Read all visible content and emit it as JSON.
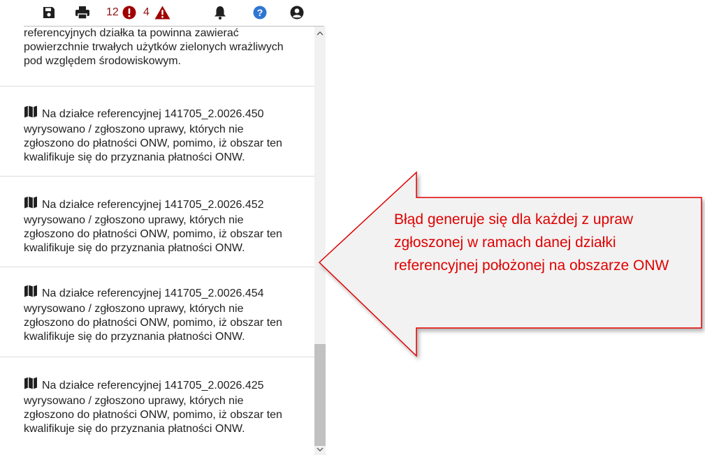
{
  "toolbar": {
    "save_icon": "save-icon",
    "print_icon": "print-icon",
    "error_count": "12",
    "warning_count": "4",
    "error_color": "#a00000",
    "warning_color": "#a00000"
  },
  "messages": [
    {
      "text": "referencyjnych działka ta powinna zawierać powierzchnie trwałych użytków zielonych wrażliwych pod względem środowiskowym.",
      "partial": true
    },
    {
      "text": "Na działce referencyjnej 141705_2.0026.450 wyrysowano / zgłoszono uprawy, których nie zgłoszono do płatności ONW, pomimo, iż obszar ten kwalifikuje się do przyznania płatności ONW."
    },
    {
      "text": "Na działce referencyjnej 141705_2.0026.452 wyrysowano / zgłoszono uprawy, których nie zgłoszono do płatności ONW, pomimo, iż obszar ten kwalifikuje się do przyznania płatności ONW."
    },
    {
      "text": "Na działce referencyjnej 141705_2.0026.454 wyrysowano / zgłoszono uprawy, których nie zgłoszono do płatności ONW, pomimo, iż obszar ten kwalifikuje się do przyznania płatności ONW."
    },
    {
      "text": "Na działce referencyjnej 141705_2.0026.425 wyrysowano / zgłoszono uprawy, których nie zgłoszono do płatności ONW, pomimo, iż obszar ten kwalifikuje się do przyznania płatności ONW."
    }
  ],
  "callout": {
    "text": "Błąd generuje się dla każdej z upraw zgłoszonej w ramach danej działki referencyjnej położonej na obszarze ONW",
    "border_color": "#e00000",
    "text_color": "#e00000"
  }
}
